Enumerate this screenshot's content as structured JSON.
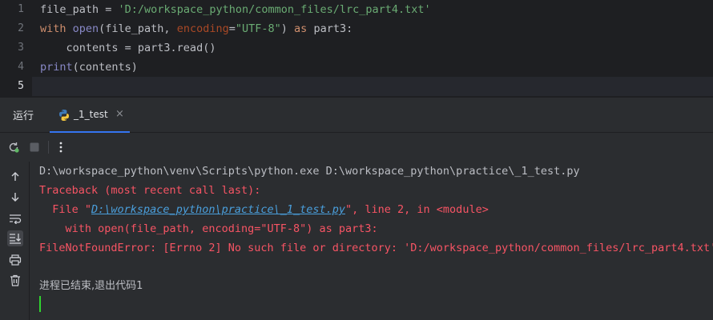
{
  "editor": {
    "line_numbers": [
      "1",
      "2",
      "3",
      "4",
      "5"
    ],
    "lines": [
      [
        {
          "t": "file_path = ",
          "c": ""
        },
        {
          "t": "'D:/workspace_python/common_files/lrc_part4.txt'",
          "c": "str"
        }
      ],
      [
        {
          "t": "with ",
          "c": "kw"
        },
        {
          "t": "open",
          "c": "bi"
        },
        {
          "t": "(file_path, ",
          "c": ""
        },
        {
          "t": "encoding",
          "c": "param"
        },
        {
          "t": "=",
          "c": ""
        },
        {
          "t": "\"UTF-8\"",
          "c": "str"
        },
        {
          "t": ") ",
          "c": ""
        },
        {
          "t": "as ",
          "c": "kw"
        },
        {
          "t": "part3:",
          "c": ""
        }
      ],
      [
        {
          "t": "    contents = part3.read()",
          "c": ""
        }
      ],
      [
        {
          "t": "print",
          "c": "bi"
        },
        {
          "t": "(contents)",
          "c": ""
        }
      ],
      [
        {
          "t": "",
          "c": ""
        }
      ]
    ]
  },
  "tool_window": {
    "title": "运行",
    "tab_label": "_1_test",
    "tab_close": "×"
  },
  "console": {
    "cmd_line": "D:\\workspace_python\\venv\\Scripts\\python.exe D:\\workspace_python\\practice\\_1_test.py",
    "traceback_header": "Traceback (most recent call last):",
    "file_prefix": "  File \"",
    "file_link": "D:\\workspace_python\\practice\\_1_test.py",
    "file_suffix": "\", line 2, in <module>",
    "code_echo": "    with open(file_path, encoding=\"UTF-8\") as part3:",
    "error_line": "FileNotFoundError: [Errno 2] No such file or directory: 'D:/workspace_python/common_files/lrc_part4.txt'",
    "exit_line": "进程已结束,退出代码1"
  },
  "colors": {
    "accent": "#3574f0",
    "error": "#f75464",
    "link": "#4a9fdc",
    "caret": "#2fd32f"
  }
}
